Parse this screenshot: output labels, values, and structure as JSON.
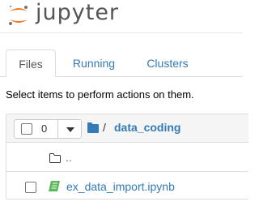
{
  "header": {
    "logo_text": "jupyter"
  },
  "tabs": [
    {
      "label": "Files",
      "active": true
    },
    {
      "label": "Running",
      "active": false
    },
    {
      "label": "Clusters",
      "active": false
    }
  ],
  "instructions": "Select items to perform actions on them.",
  "toolbar": {
    "selected_count": "0",
    "dropdown_icon": "caret-down-icon",
    "folder_icon": "folder-open-icon",
    "separator": "/",
    "current_dir": "data_coding"
  },
  "file_list": {
    "parent_dir": {
      "label": "..",
      "icon": "folder-outline-icon"
    },
    "items": [
      {
        "name": "ex_data_import.ipynb",
        "icon": "notebook-icon",
        "selected": false
      }
    ]
  },
  "colors": {
    "link": "#337ab7",
    "notebook_icon": "#5cb85c",
    "logo_orange": "#f37726"
  }
}
